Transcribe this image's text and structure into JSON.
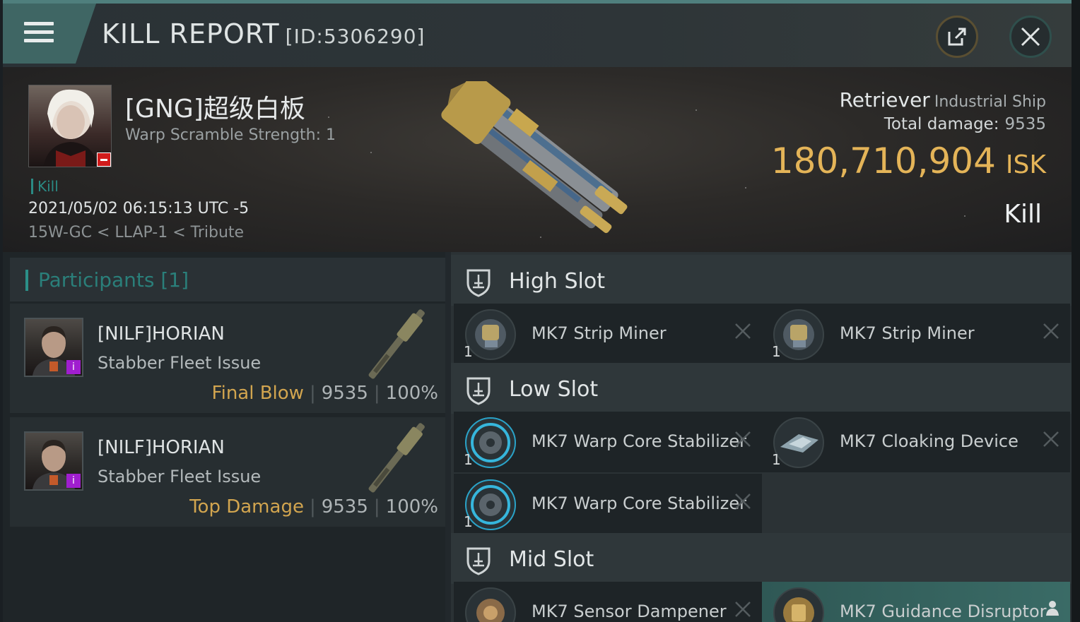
{
  "header": {
    "title": "KILL REPORT",
    "report_id": "[ID:5306290]",
    "menu_icon": "hamburger-menu-icon",
    "share_icon": "external-share-icon",
    "close_icon": "close-icon"
  },
  "victim": {
    "name": "[GNG]超级白板",
    "warp_scramble": "Warp Scramble Strength: 1",
    "tag": "Kill",
    "datetime": "2021/05/02 06:15:13 UTC -5",
    "location": "15W-GC < LLAP-1 < Tribute"
  },
  "ship": {
    "name": "Retriever",
    "class": "Industrial Ship",
    "total_damage_label": "Total damage:",
    "total_damage_value": "9535",
    "isk_value": "180,710,904",
    "isk_unit": "ISK",
    "result": "Kill"
  },
  "participants": {
    "header": "Participants [1]",
    "rows": [
      {
        "name": "[NILF]HORIAN",
        "ship": "Stabber Fleet Issue",
        "role": "Final Blow",
        "damage": "9535",
        "percent": "100%"
      },
      {
        "name": "[NILF]HORIAN",
        "ship": "Stabber Fleet Issue",
        "role": "Top Damage",
        "damage": "9535",
        "percent": "100%"
      }
    ]
  },
  "slots": {
    "high": {
      "label": "High Slot",
      "items": [
        {
          "name": "MK7 Strip Miner",
          "qty": "1"
        },
        {
          "name": "MK7 Strip Miner",
          "qty": "1"
        }
      ]
    },
    "low": {
      "label": "Low Slot",
      "items": [
        {
          "name": "MK7 Warp Core Stabilizer",
          "qty": "1"
        },
        {
          "name": "MK7 Cloaking Device",
          "qty": "1"
        },
        {
          "name": "MK7 Warp Core Stabilizer",
          "qty": "1"
        }
      ]
    },
    "mid": {
      "label": "Mid Slot",
      "items": [
        {
          "name": "MK7 Sensor Dampener",
          "qty": ""
        },
        {
          "name": "MK7 Guidance Disruptor",
          "qty": ""
        }
      ]
    }
  },
  "colors": {
    "accent_teal": "#2b8f88",
    "isk_gold": "#e4b458",
    "role_gold": "#d2a54f"
  }
}
